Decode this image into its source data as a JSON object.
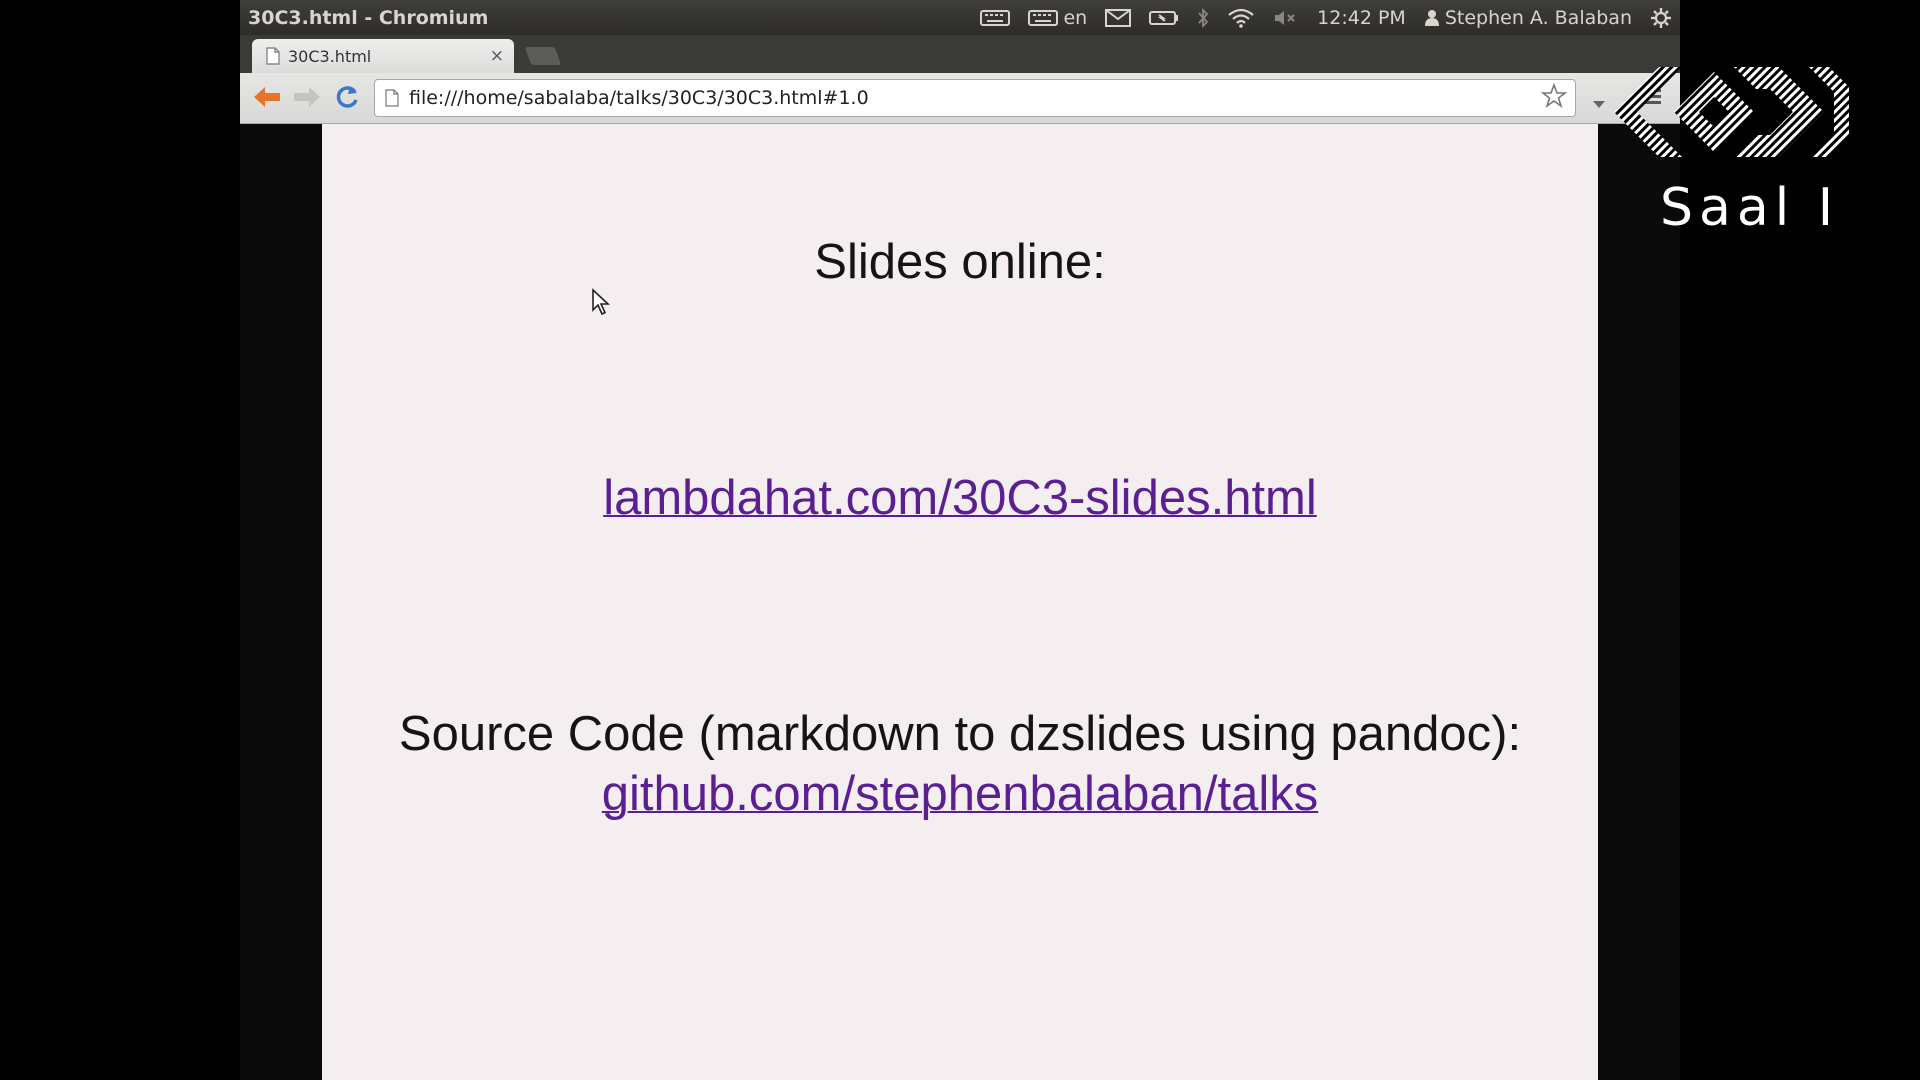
{
  "panel": {
    "window_title": "30C3.html - Chromium",
    "keyboard_layout": "en",
    "time": "12:42 PM",
    "user_name": "Stephen A. Balaban",
    "icons": [
      "keyboard-icon",
      "keyboard-layout-icon",
      "mail-icon",
      "battery-icon",
      "bluetooth-icon",
      "wifi-icon",
      "volume-muted-icon",
      "user-icon",
      "session-gear-icon"
    ]
  },
  "tabs": [
    {
      "label": "30C3.html",
      "close_label": "×"
    }
  ],
  "omnibox": {
    "url": "file:///home/sabalaba/talks/30C3/30C3.html#1.0"
  },
  "slide": {
    "heading": "Slides online:",
    "slides_link": "lambdahat.com/30C3-slides.html",
    "source_heading": "Source Code (markdown to dzslides using pandoc):",
    "source_link": "github.com/stephenbalaban/talks"
  },
  "overlay": {
    "room_label": "Saal I"
  },
  "colors": {
    "panel_bg": "#3a3935",
    "slide_bg": "#f4eef1",
    "link": "#5a1f91",
    "back_arrow": "#e8742a",
    "reload": "#3a78c8"
  }
}
